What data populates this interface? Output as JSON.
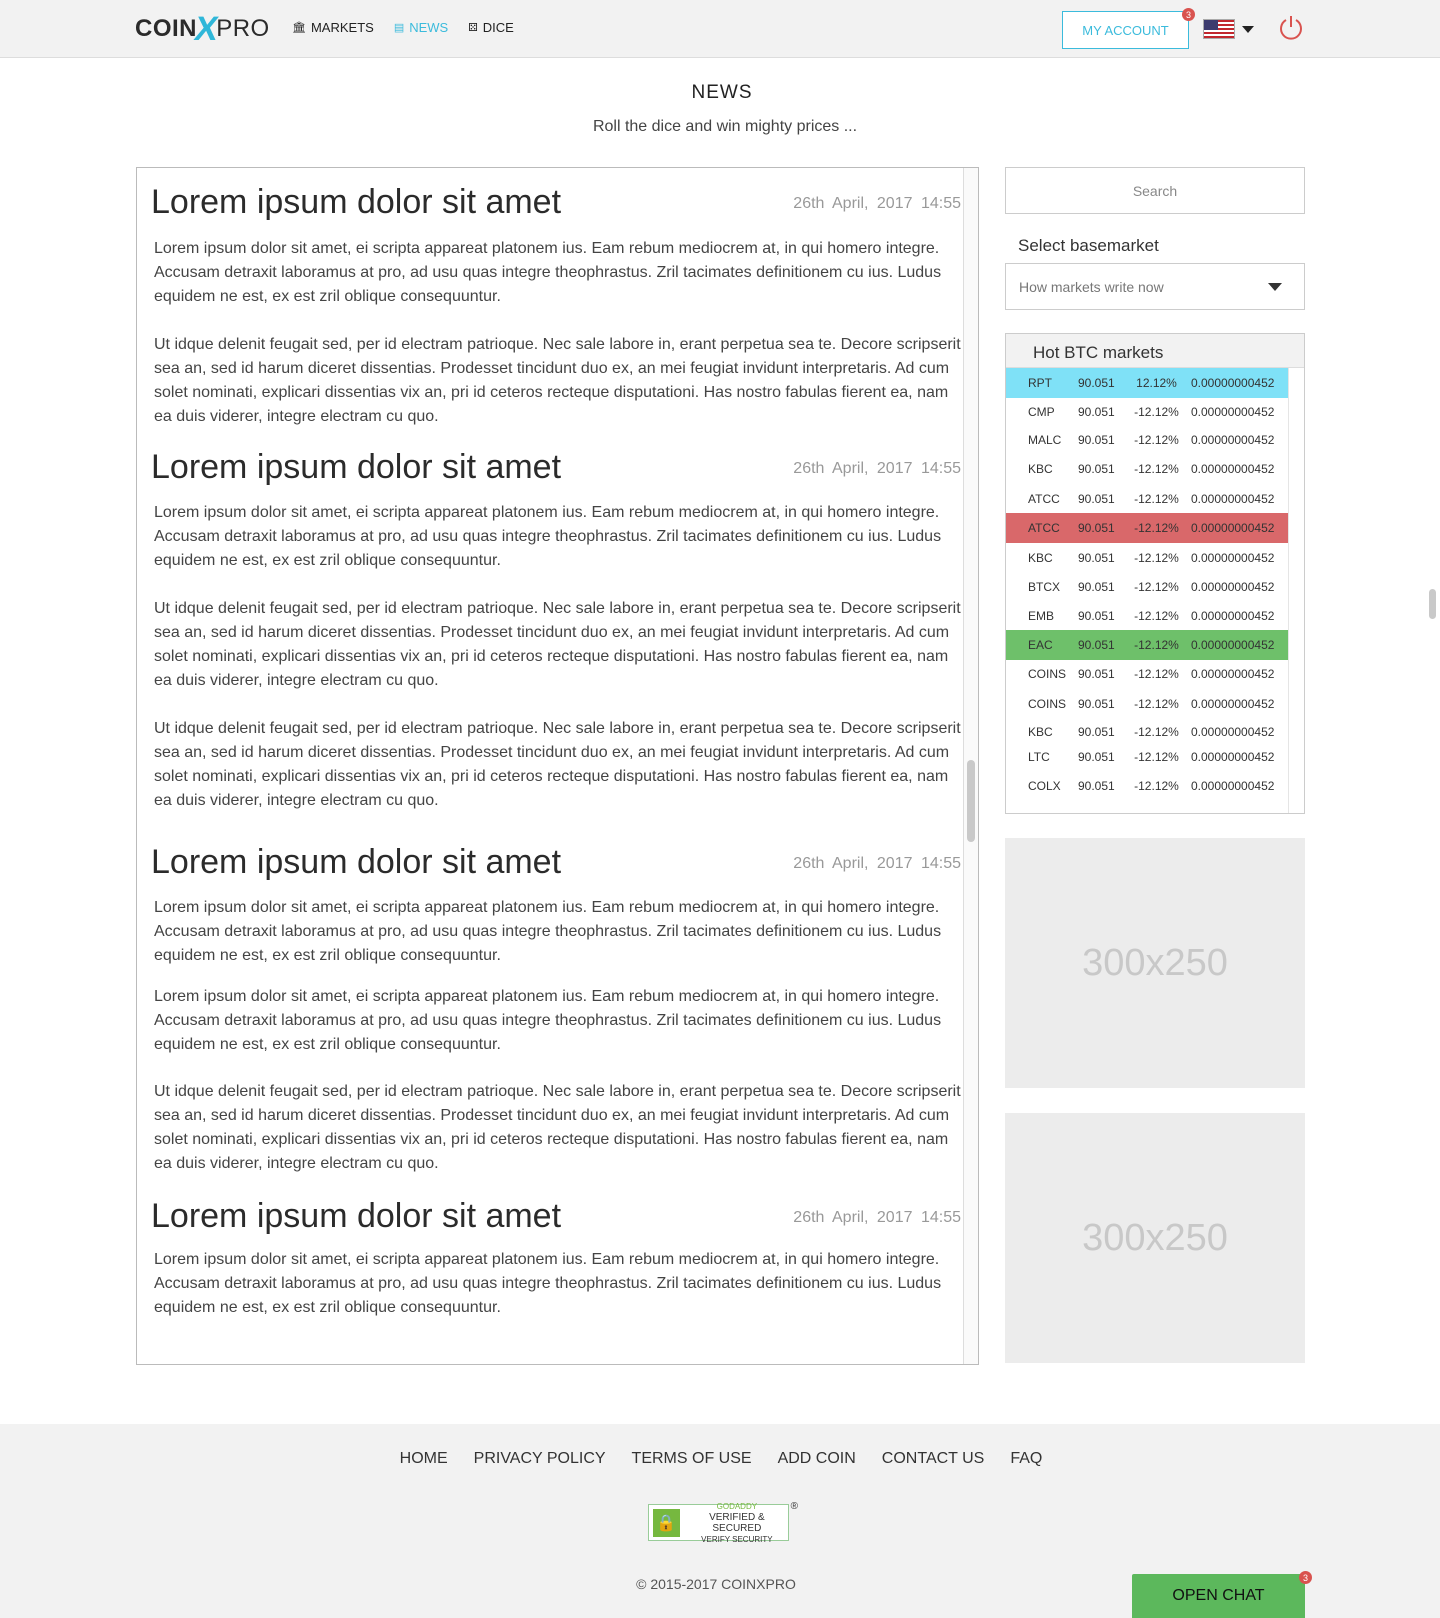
{
  "header": {
    "logo": {
      "coin": "COIN",
      "x": "X",
      "pro": "PRO"
    },
    "nav": [
      {
        "label": "MARKETS",
        "icon": "bank-icon"
      },
      {
        "label": "NEWS",
        "icon": "newspaper-icon",
        "active": true
      },
      {
        "label": "DICE",
        "icon": "dice-icon"
      }
    ],
    "account_label": "MY ACCOUNT",
    "account_badge": "3",
    "language_icon": "us-flag-icon",
    "power_icon": "power-icon",
    "accent_color": "#3bbbdc"
  },
  "page": {
    "title": "NEWS",
    "subtitle": "Roll the dice and win mighty prices ..."
  },
  "articles": [
    {
      "title": "Lorem ipsum dolor sit amet",
      "date": "26th April, 2017",
      "time": "14:55",
      "paragraphs": [
        "Lorem ipsum dolor sit amet, ei scripta appareat platonem ius. Eam rebum mediocrem at, in qui homero integre. Accusam detraxit laboramus at pro, ad usu quas integre theophrastus. Zril tacimates definitionem cu ius. Ludus equidem ne est, ex est zril oblique consequuntur.",
        "Ut idque delenit feugait sed, per id electram patrioque. Nec sale labore in, erant perpetua sea te. Decore scripserit sea an, sed id harum diceret dissentias. Prodesset tincidunt duo ex, an mei feugiat invidunt interpretaris. Ad cum solet nominati, explicari dissentias vix an, pri id ceteros recteque disputationi. Has nostro fabulas fierent ea, nam ea duis viderer, integre electram cu quo."
      ]
    },
    {
      "title": "Lorem ipsum dolor sit amet",
      "date": "26th April, 2017",
      "time": "14:55",
      "paragraphs": [
        "Lorem ipsum dolor sit amet, ei scripta appareat platonem ius. Eam rebum mediocrem at, in qui homero integre. Accusam detraxit laboramus at pro, ad usu quas integre theophrastus. Zril tacimates definitionem cu ius. Ludus equidem ne est, ex est zril oblique consequuntur.",
        "Ut idque delenit feugait sed, per id electram patrioque. Nec sale labore in, erant perpetua sea te. Decore scripserit sea an, sed id harum diceret dissentias. Prodesset tincidunt duo ex, an mei feugiat invidunt interpretaris. Ad cum solet nominati, explicari dissentias vix an, pri id ceteros recteque disputationi. Has nostro fabulas fierent ea, nam ea duis viderer, integre electram cu quo.",
        "Ut idque delenit feugait sed, per id electram patrioque. Nec sale labore in, erant perpetua sea te. Decore scripserit sea an, sed id harum diceret dissentias. Prodesset tincidunt duo ex, an mei feugiat invidunt interpretaris. Ad cum solet nominati, explicari dissentias vix an, pri id ceteros recteque disputationi. Has nostro fabulas fierent ea, nam ea duis viderer, integre electram cu quo."
      ]
    },
    {
      "title": "Lorem ipsum dolor sit amet",
      "date": "26th April, 2017",
      "time": "14:55",
      "paragraphs": [
        "Lorem ipsum dolor sit amet, ei scripta appareat platonem ius. Eam rebum mediocrem at, in qui homero integre. Accusam detraxit laboramus at pro, ad usu quas integre theophrastus. Zril tacimates definitionem cu ius. Ludus equidem ne est, ex est zril oblique consequuntur.",
        "Lorem ipsum dolor sit amet, ei scripta appareat platonem ius. Eam rebum mediocrem at, in qui homero integre. Accusam detraxit laboramus at pro, ad usu quas integre theophrastus. Zril tacimates definitionem cu ius. Ludus equidem ne est, ex est zril oblique consequuntur.",
        "Ut idque delenit feugait sed, per id electram patrioque. Nec sale labore in, erant perpetua sea te. Decore scripserit sea an, sed id harum diceret dissentias. Prodesset tincidunt duo ex, an mei feugiat invidunt interpretaris. Ad cum solet nominati, explicari dissentias vix an, pri id ceteros recteque disputationi. Has nostro fabulas fierent ea, nam ea duis viderer, integre electram cu quo."
      ]
    },
    {
      "title": "Lorem ipsum dolor sit amet",
      "date": "26th April, 2017",
      "time": "14:55",
      "paragraphs": [
        "Lorem ipsum dolor sit amet, ei scripta appareat platonem ius. Eam rebum mediocrem at, in qui homero integre. Accusam detraxit laboramus at pro, ad usu quas integre theophrastus. Zril tacimates definitionem cu ius. Ludus equidem ne est, ex est zril oblique consequuntur."
      ]
    }
  ],
  "sidebar": {
    "search_placeholder": "Search",
    "select_label": "Select basemarket",
    "select_value": "How markets write now",
    "hot_title": "Hot BTC markets",
    "hot_rows": [
      {
        "sym": "RPT",
        "price": "90.051",
        "change": "12.12%",
        "vol": "0.00000000452",
        "highlight": "#7fe1f7"
      },
      {
        "sym": "CMP",
        "price": "90.051",
        "change": "-12.12%",
        "vol": "0.00000000452"
      },
      {
        "sym": "MALC",
        "price": "90.051",
        "change": "-12.12%",
        "vol": "0.00000000452"
      },
      {
        "sym": "KBC",
        "price": "90.051",
        "change": "-12.12%",
        "vol": "0.00000000452"
      },
      {
        "sym": "ATCC",
        "price": "90.051",
        "change": "-12.12%",
        "vol": "0.00000000452"
      },
      {
        "sym": "ATCC",
        "price": "90.051",
        "change": "-12.12%",
        "vol": "0.00000000452",
        "highlight": "#d9686a"
      },
      {
        "sym": "KBC",
        "price": "90.051",
        "change": "-12.12%",
        "vol": "0.00000000452"
      },
      {
        "sym": "BTCX",
        "price": "90.051",
        "change": "-12.12%",
        "vol": "0.00000000452"
      },
      {
        "sym": "EMB",
        "price": "90.051",
        "change": "-12.12%",
        "vol": "0.00000000452"
      },
      {
        "sym": "EAC",
        "price": "90.051",
        "change": "-12.12%",
        "vol": "0.00000000452",
        "highlight": "#6ec06a"
      },
      {
        "sym": "COINS",
        "price": "90.051",
        "change": "-12.12%",
        "vol": "0.00000000452"
      },
      {
        "sym": "COINS",
        "price": "90.051",
        "change": "-12.12%",
        "vol": "0.00000000452"
      },
      {
        "sym": "KBC",
        "price": "90.051",
        "change": "-12.12%",
        "vol": "0.00000000452"
      },
      {
        "sym": "LTC",
        "price": "90.051",
        "change": "-12.12%",
        "vol": "0.00000000452"
      },
      {
        "sym": "COLX",
        "price": "90.051",
        "change": "-12.12%",
        "vol": "0.00000000452"
      }
    ],
    "ads": [
      "300x250",
      "300x250"
    ]
  },
  "footer": {
    "links": [
      "HOME",
      "PRIVACY POLICY",
      "TERMS OF USE",
      "ADD COIN",
      "CONTACT US",
      "FAQ"
    ],
    "seal": {
      "brand": "GODADDY",
      "line1": "VERIFIED & SECURED",
      "line2": "VERIFY SECURITY",
      "reg": "®"
    },
    "copyright": "© 2015-2017 COINXPRO"
  },
  "chat": {
    "label": "OPEN CHAT",
    "badge": "3"
  }
}
